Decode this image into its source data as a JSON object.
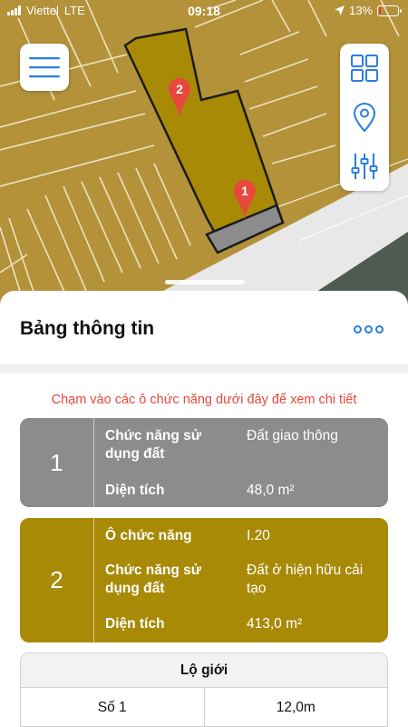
{
  "status_bar": {
    "carrier": "Viettel",
    "network": "LTE",
    "time": "09:18",
    "battery_percent": "13%",
    "battery_level": 0.13
  },
  "map": {
    "markers": [
      {
        "label": "1",
        "color": "#e8483b"
      },
      {
        "label": "2",
        "color": "#e8483b"
      }
    ],
    "parcel_color": "#a88a07",
    "road_parcel_color": "#8c8c8c"
  },
  "controls": {
    "menu_icon": "hamburger-menu-icon",
    "tool_icons": [
      "grid-layers-icon",
      "location-pin-icon",
      "sliders-icon"
    ],
    "accent": "#2a7de1"
  },
  "sheet": {
    "title": "Bảng thông tin",
    "more_icon": "more-options-icon",
    "hint": "Chạm vào các ô chức năng dưới đây để xem chi tiết",
    "hint_color": "#e8483b"
  },
  "cards": [
    {
      "number": "1",
      "color": "#8c8c8c",
      "rows": [
        {
          "label": "Chức năng sử dụng đất",
          "value": "Đất giao thông"
        },
        {
          "label": "Diện tích",
          "value": "48,0 m²"
        }
      ]
    },
    {
      "number": "2",
      "color": "#a88a07",
      "rows": [
        {
          "label": "Ô chức năng",
          "value": "I.20"
        },
        {
          "label": "Chức năng sử dụng đất",
          "value": "Đất ở hiện hữu cải tạo"
        },
        {
          "label": "Diện tích",
          "value": "413,0 m²"
        }
      ]
    }
  ],
  "road_table": {
    "header": "Lộ giới",
    "rows": [
      {
        "name": "Số 1",
        "width": "12,0m"
      }
    ]
  }
}
